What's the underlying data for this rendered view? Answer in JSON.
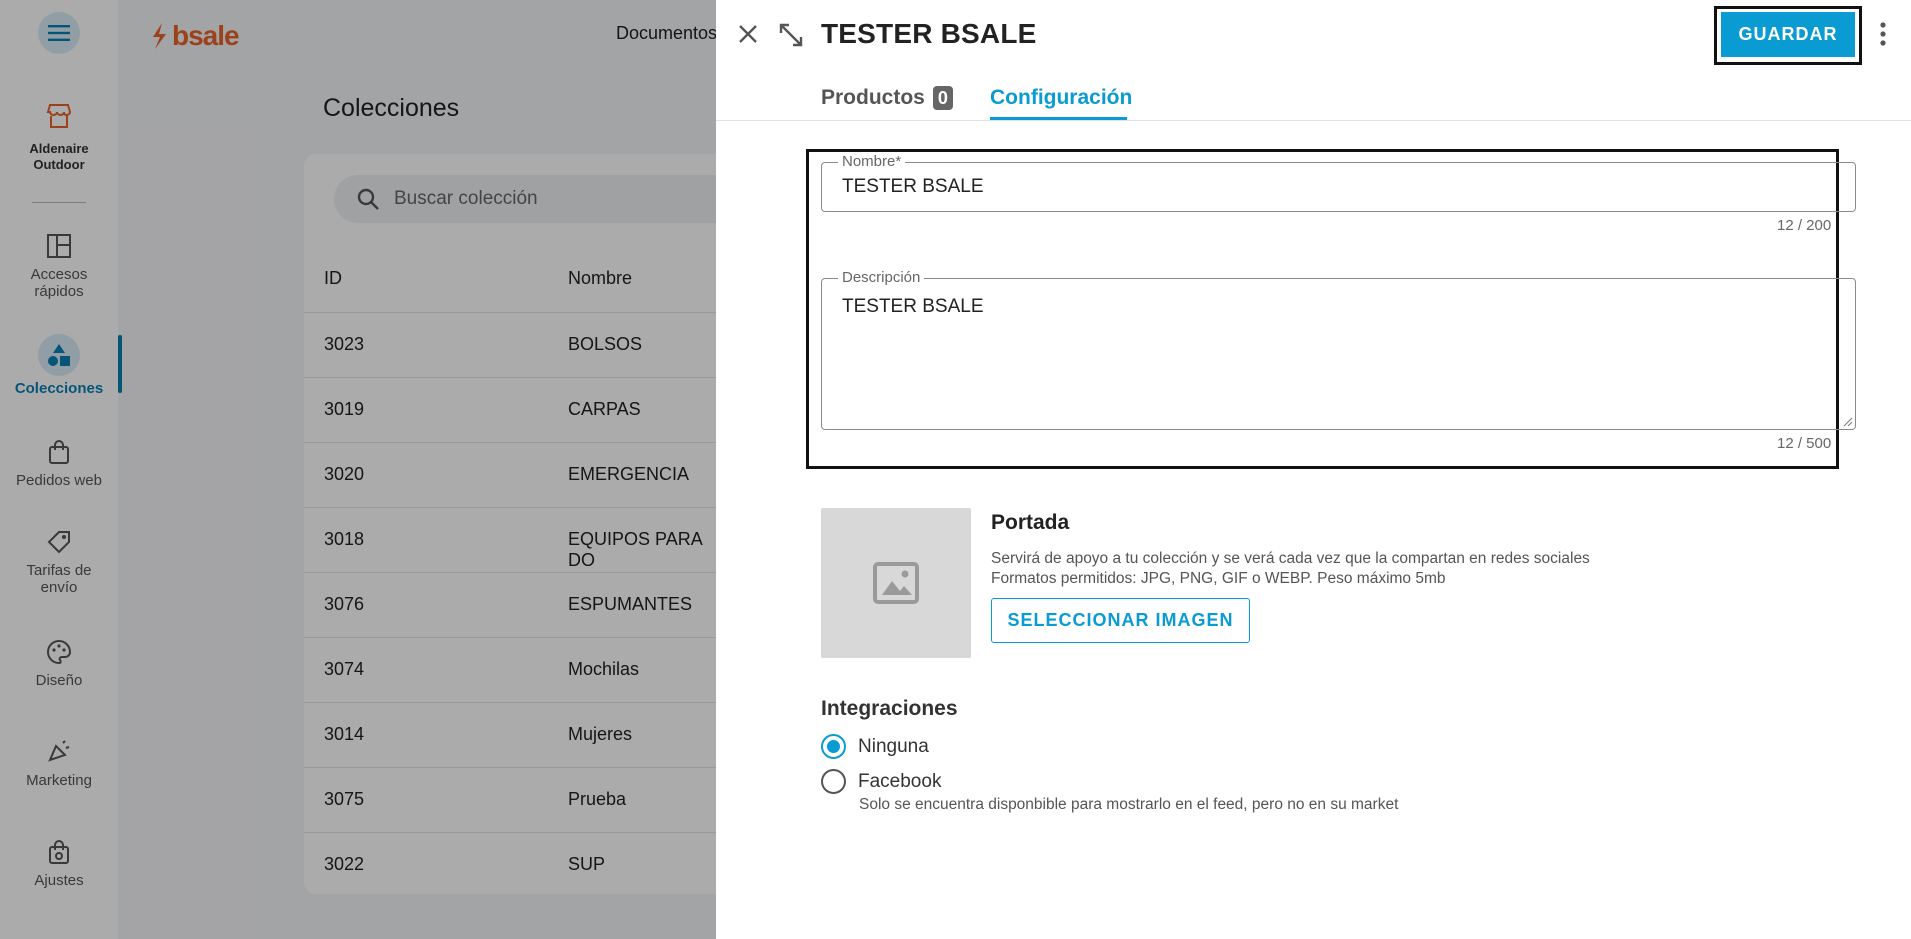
{
  "sidebar": {
    "store_name_line1": "Aldenaire",
    "store_name_line2": "Outdoor",
    "items": [
      {
        "label_line1": "Accesos",
        "label_line2": "rápidos",
        "icon": "layout-icon"
      },
      {
        "label_line1": "Colecciones",
        "label_line2": "",
        "icon": "shapes-icon"
      },
      {
        "label_line1": "Pedidos web",
        "label_line2": "",
        "icon": "bag-icon"
      },
      {
        "label_line1": "Tarifas de",
        "label_line2": "envío",
        "icon": "tag-icon"
      },
      {
        "label_line1": "Diseño",
        "label_line2": "",
        "icon": "palette-icon"
      },
      {
        "label_line1": "Marketing",
        "label_line2": "",
        "icon": "megaphone-icon"
      },
      {
        "label_line1": "Ajustes",
        "label_line2": "",
        "icon": "settings-bag-icon"
      }
    ]
  },
  "topbar": {
    "logo": "bsale",
    "documents_label": "Documentos"
  },
  "page": {
    "title": "Colecciones",
    "search_placeholder": "Buscar colección",
    "columns": [
      "ID",
      "Nombre"
    ],
    "rows": [
      {
        "id": "3023",
        "name": "BOLSOS"
      },
      {
        "id": "3019",
        "name": "CARPAS"
      },
      {
        "id": "3020",
        "name": "EMERGENCIA"
      },
      {
        "id": "3018",
        "name": "EQUIPOS PARA DO"
      },
      {
        "id": "3076",
        "name": "ESPUMANTES"
      },
      {
        "id": "3074",
        "name": "Mochilas"
      },
      {
        "id": "3014",
        "name": "Mujeres"
      },
      {
        "id": "3075",
        "name": "Prueba"
      },
      {
        "id": "3022",
        "name": "SUP"
      }
    ]
  },
  "drawer": {
    "title": "TESTER BSALE",
    "save_label": "GUARDAR",
    "tabs": [
      {
        "label": "Productos",
        "badge": "0"
      },
      {
        "label": "Configuración"
      }
    ],
    "name_field": {
      "label": "Nombre*",
      "value": "TESTER BSALE",
      "counter": "12 / 200"
    },
    "description_field": {
      "label": "Descripción",
      "value": "TESTER BSALE",
      "counter": "12 / 500"
    },
    "cover": {
      "title": "Portada",
      "desc_line1": "Servirá de apoyo a tu colección y se verá cada vez que la compartan en redes sociales",
      "desc_line2": "Formatos permitidos: JPG, PNG, GIF o WEBP. Peso máximo 5mb",
      "button": "SELECCIONAR IMAGEN"
    },
    "integrations": {
      "title": "Integraciones",
      "options": [
        {
          "label": "Ninguna",
          "selected": true
        },
        {
          "label": "Facebook",
          "selected": false
        }
      ],
      "facebook_hint": "Solo se encuentra disponbible para mostrarlo en el feed, pero no en su market"
    }
  },
  "colors": {
    "accent": "#0a9bd3",
    "brand": "#e8632b"
  }
}
